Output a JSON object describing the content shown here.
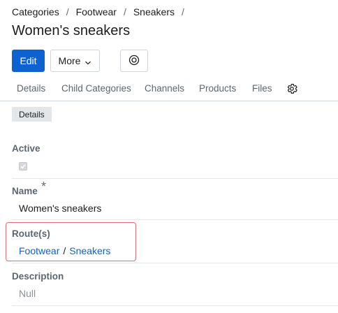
{
  "breadcrumb": [
    "Categories",
    "Footwear",
    "Sneakers"
  ],
  "breadcrumb_separator": "/",
  "page_title": "Women's sneakers",
  "toolbar": {
    "edit_label": "Edit",
    "more_label": "More",
    "view_icon": "view-icon"
  },
  "tabs": [
    "Details",
    "Child Categories",
    "Channels",
    "Products",
    "Files"
  ],
  "tabs_settings_icon": "gear-icon",
  "section_badge": "Details",
  "fields": {
    "active": {
      "label": "Active",
      "checked": true
    },
    "name": {
      "label": "Name",
      "required_mark": "*",
      "value": "Women's sneakers"
    },
    "routes": {
      "label": "Route(s)",
      "items": [
        "Footwear",
        "Sneakers"
      ],
      "separator": "/"
    },
    "description": {
      "label": "Description",
      "value": "Null"
    }
  },
  "colors": {
    "primary": "#0b62d0",
    "highlight_border": "#e06c72",
    "muted_text": "#5c6670"
  }
}
